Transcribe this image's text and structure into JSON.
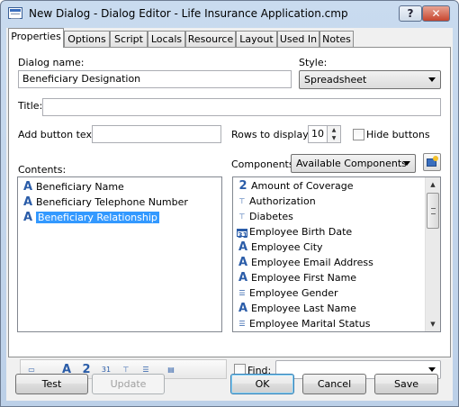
{
  "window": {
    "title": "New Dialog - Dialog Editor - Life Insurance Application.cmp",
    "help": "?",
    "close": "✕"
  },
  "tabs": [
    "Properties",
    "Options",
    "Script",
    "Locals",
    "Resource",
    "Layout",
    "Used In",
    "Notes"
  ],
  "fields": {
    "dialog_name_label": "Dialog name:",
    "dialog_name_value": "Beneficiary Designation",
    "style_label": "Style:",
    "style_value": "Spreadsheet",
    "title_label": "Title:",
    "title_value": "",
    "add_button_label": "Add button text:",
    "add_button_value": "",
    "rows_label": "Rows to display:",
    "rows_value": "10",
    "hide_buttons_label": "Hide buttons",
    "contents_label": "Contents:",
    "components_label": "Components:",
    "components_value": "Available Components",
    "find_label": "Find:",
    "find_value": ""
  },
  "contents": [
    {
      "icon": "text-icon",
      "label": "Beneficiary Name"
    },
    {
      "icon": "text-icon",
      "label": "Beneficiary Telephone Number"
    },
    {
      "icon": "text-icon",
      "label": "Beneficiary Relationship",
      "selected": true
    }
  ],
  "components": [
    {
      "icon": "number-icon",
      "label": "Amount of Coverage"
    },
    {
      "icon": "tree-icon",
      "label": "Authorization"
    },
    {
      "icon": "tree-icon",
      "label": "Diabetes"
    },
    {
      "icon": "calendar-icon",
      "label": "Employee Birth Date"
    },
    {
      "icon": "text-icon",
      "label": "Employee City"
    },
    {
      "icon": "text-icon",
      "label": "Employee Email Address"
    },
    {
      "icon": "text-icon",
      "label": "Employee First Name"
    },
    {
      "icon": "list-icon",
      "label": "Employee Gender"
    },
    {
      "icon": "text-icon",
      "label": "Employee Last Name"
    },
    {
      "icon": "list-icon",
      "label": "Employee Marital Status"
    }
  ],
  "buttons": {
    "test": "Test",
    "update": "Update",
    "ok": "OK",
    "cancel": "Cancel",
    "save": "Save"
  }
}
